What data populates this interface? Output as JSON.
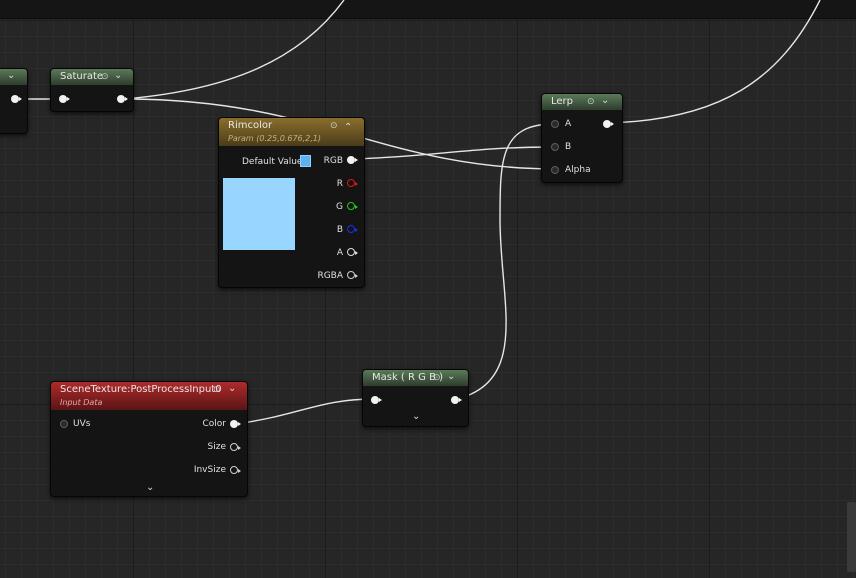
{
  "nodes": {
    "saturate": {
      "title": "Saturate"
    },
    "rimcolor": {
      "title": "Rimcolor",
      "subtitle": "Param (0.25,0.676,2,1)",
      "default_value_label": "Default Value",
      "swatch_color": "#99d6ff",
      "outputs": {
        "rgb": "RGB",
        "r": "R",
        "g": "G",
        "b": "B",
        "a": "A",
        "rgba": "RGBA"
      }
    },
    "lerp": {
      "title": "Lerp",
      "inputs": {
        "a": "A",
        "b": "B",
        "alpha": "Alpha"
      }
    },
    "mask": {
      "title": "Mask ( R G B )"
    },
    "scene_texture": {
      "title": "SceneTexture:PostProcessInput0",
      "subtitle": "Input Data",
      "inputs": {
        "uvs": "UVs"
      },
      "outputs": {
        "color": "Color",
        "size": "Size",
        "invsize": "InvSize"
      }
    }
  },
  "icons": {
    "header_options": "circle-dot-icon",
    "collapse": "chevron-down-icon",
    "expand_up": "chevron-up-icon",
    "expand_more": "chevron-down-icon"
  },
  "colors": {
    "grid_bg": "#262626",
    "wire": "#e8e8e8",
    "pin_r": "#e01818",
    "pin_g": "#1ecc1e",
    "pin_b": "#1c2cf0"
  }
}
